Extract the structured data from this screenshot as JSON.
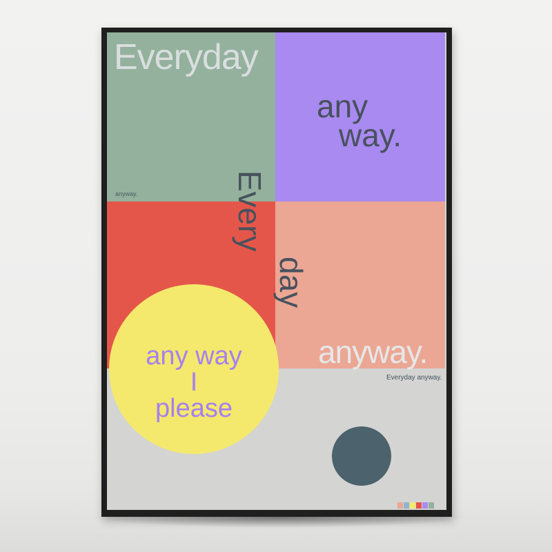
{
  "poster": {
    "headline": "Everyday",
    "small_label": "anyway.",
    "any_way_line1": "any",
    "any_way_line2": "way.",
    "every_vertical": "Every",
    "day_vertical": "day",
    "anyway_salmon": "anyway.",
    "tagline": "Everyday anyway.",
    "circle_lines": [
      "any way",
      "I",
      "please"
    ],
    "colors": {
      "green": "#93b19d",
      "purple": "#a98af0",
      "red": "#e5564a",
      "salmon": "#eba794",
      "yellow": "#f4e96c",
      "dark_circle": "#4c626c",
      "background": "#d4d4d3"
    },
    "swatches": [
      "#eba794",
      "#93b19d",
      "#f4e96c",
      "#e5564a",
      "#a98af0",
      "#93b19d"
    ]
  }
}
